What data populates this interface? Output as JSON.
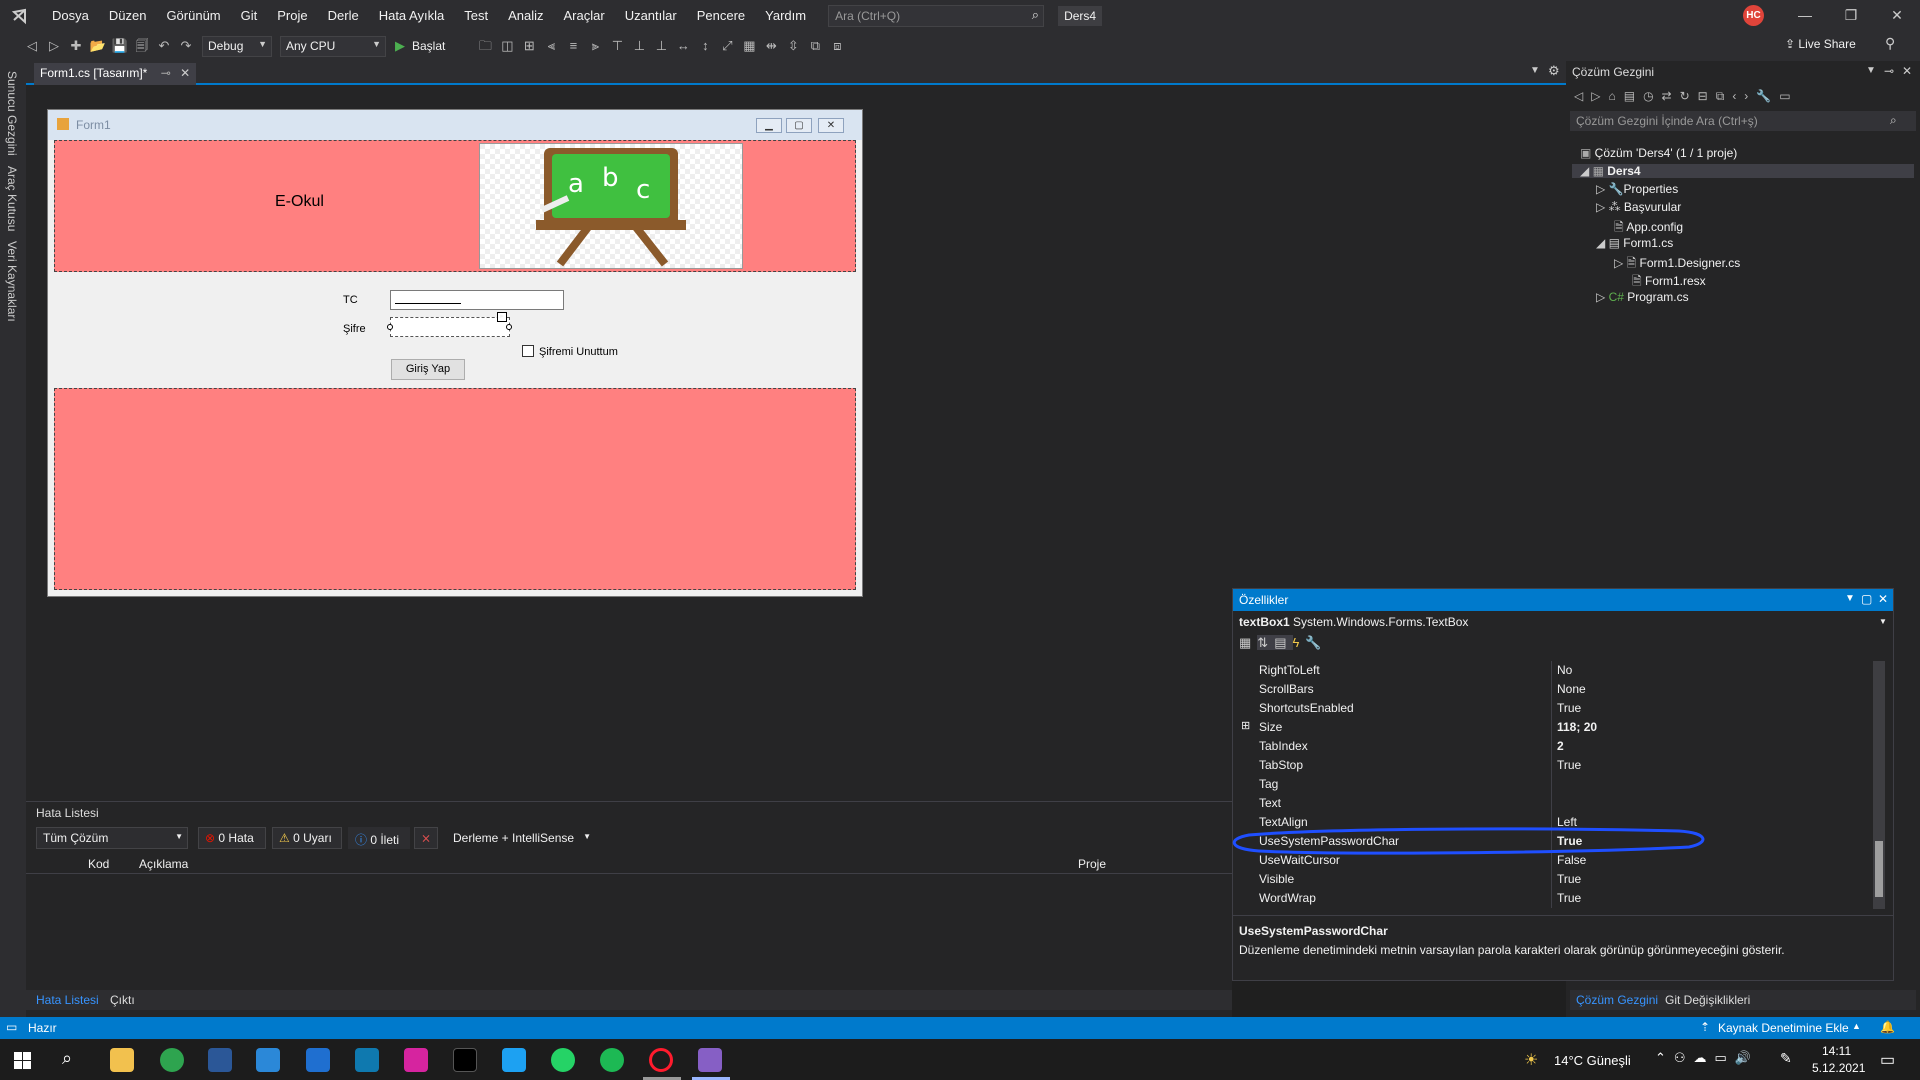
{
  "menubar": {
    "items": [
      "Dosya",
      "Düzen",
      "Görünüm",
      "Git",
      "Proje",
      "Derle",
      "Hata Ayıkla",
      "Test",
      "Analiz",
      "Araçlar",
      "Uzantılar",
      "Pencere",
      "Yardım"
    ],
    "search_placeholder": "Ara (Ctrl+Q)",
    "solution_name": "Ders4",
    "avatar_initials": "HC"
  },
  "toolbar": {
    "config": "Debug",
    "platform": "Any CPU",
    "start_label": "Başlat",
    "live_share": "Live Share"
  },
  "left_rail": {
    "tabs": [
      "Sunucu Gezgini",
      "Araç Kutusu",
      "Veri Kaynakları"
    ]
  },
  "document_tab": {
    "label": "Form1.cs [Tasarım]*"
  },
  "form": {
    "title": "Form1",
    "header_text": "E-Okul",
    "tc_label": "TC",
    "sifre_label": "Şifre",
    "forgot_label": "Şifremi Unuttum",
    "login_button": "Giriş Yap",
    "panel_color": "#ff8080"
  },
  "solution_explorer": {
    "title": "Çözüm Gezgini",
    "search_placeholder": "Çözüm Gezgini İçinde Ara (Ctrl+ş)",
    "items": [
      "Çözüm 'Ders4' (1 / 1 proje)",
      "Ders4",
      "Properties",
      "Başvurular",
      "App.config",
      "Form1.cs",
      "Form1.Designer.cs",
      "Form1.resx",
      "Program.cs"
    ],
    "bottom_tabs": [
      "Çözüm Gezgini",
      "Git Değişiklikleri"
    ]
  },
  "error_list": {
    "title": "Hata Listesi",
    "scope": "Tüm Çözüm",
    "errors": "0 Hata",
    "warnings": "0 Uyarı",
    "messages": "0 İleti",
    "build_filter": "Derleme + IntelliSense",
    "columns": [
      "Kod",
      "Açıklama",
      "Proje"
    ],
    "bottom_tabs": [
      "Hata Listesi",
      "Çıktı"
    ]
  },
  "properties": {
    "title": "Özellikler",
    "object_name": "textBox1",
    "object_type": "System.Windows.Forms.TextBox",
    "rows": [
      {
        "name": "RightToLeft",
        "value": "No"
      },
      {
        "name": "ScrollBars",
        "value": "None"
      },
      {
        "name": "ShortcutsEnabled",
        "value": "True"
      },
      {
        "name": "Size",
        "value": "118; 20"
      },
      {
        "name": "TabIndex",
        "value": "2"
      },
      {
        "name": "TabStop",
        "value": "True"
      },
      {
        "name": "Tag",
        "value": ""
      },
      {
        "name": "Text",
        "value": ""
      },
      {
        "name": "TextAlign",
        "value": "Left"
      },
      {
        "name": "UseSystemPasswordChar",
        "value": "True"
      },
      {
        "name": "UseWaitCursor",
        "value": "False"
      },
      {
        "name": "Visible",
        "value": "True"
      },
      {
        "name": "WordWrap",
        "value": "True"
      }
    ],
    "desc_title": "UseSystemPasswordChar",
    "desc_text": "Düzenleme denetimindeki metnin varsayılan parola karakteri olarak görünüp görünmeyeceğini gösterir.",
    "highlight_color": "#1f4fff"
  },
  "statusbar": {
    "state": "Hazır",
    "source_control": "Kaynak Denetimine Ekle"
  },
  "taskbar": {
    "weather": "14°C  Güneşli",
    "time": "14:11",
    "date": "5.12.2021"
  }
}
